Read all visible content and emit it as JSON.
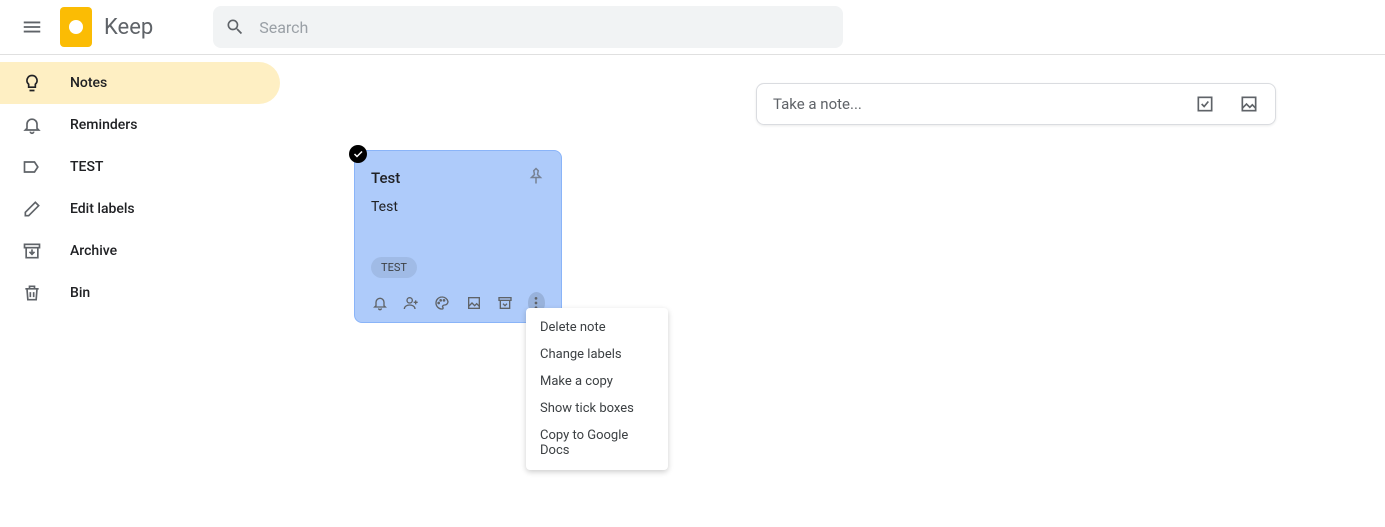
{
  "header": {
    "app_name": "Keep",
    "search_placeholder": "Search"
  },
  "sidebar": {
    "items": [
      {
        "label": "Notes"
      },
      {
        "label": "Reminders"
      },
      {
        "label": "TEST"
      },
      {
        "label": "Edit labels"
      },
      {
        "label": "Archive"
      },
      {
        "label": "Bin"
      }
    ]
  },
  "take_note": {
    "placeholder": "Take a note..."
  },
  "note": {
    "title": "Test",
    "body": "Test",
    "label": "TEST"
  },
  "context_menu": {
    "items": [
      "Delete note",
      "Change labels",
      "Make a copy",
      "Show tick boxes",
      "Copy to Google Docs"
    ]
  }
}
